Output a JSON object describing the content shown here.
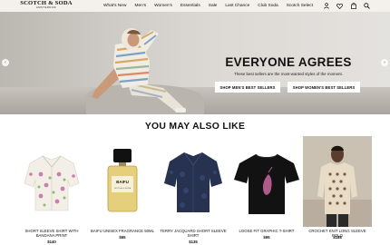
{
  "header": {
    "brand": "SCOTCH & SODA",
    "brand_city": "AMSTERDAM",
    "nav": [
      "What's New",
      "Men's",
      "Women's",
      "Essentials",
      "Sale",
      "Last Chance",
      "Club Soda",
      "Scotch Select"
    ],
    "icons": [
      "user-icon",
      "heart-icon",
      "bag-icon",
      "search-icon"
    ]
  },
  "hero": {
    "title": "EVERYONE AGREES",
    "subtitle": "These best sellers are the most-wanted styles of the moment.",
    "buttons": [
      "SHOP MEN'S BEST SELLERS",
      "SHOP WOMEN'S BEST SELLERS"
    ]
  },
  "recommendations": {
    "title": "YOU MAY ALSO LIKE",
    "products": [
      {
        "name": "SHORT SLEEVE SHIRT WITH BANDANA PRINT",
        "price": "$140"
      },
      {
        "name": "BAIFU UNISEX FRAGRANCE 50ML",
        "price": "$65"
      },
      {
        "name": "TERRY JACQUARD SHORT SLEEVE SHIRT",
        "price": "$135"
      },
      {
        "name": "LOOSE FIT GRAPHIC T-SHIRT",
        "price": "$65"
      },
      {
        "name": "CROCHET KNIT LONG SLEEVE POLO",
        "price": "$188"
      }
    ]
  },
  "colors": {
    "topbar_bg": "#f4f1ec",
    "hero_bg": "#d6d3ce",
    "button_bg": "#ffffff",
    "text": "#111111"
  }
}
